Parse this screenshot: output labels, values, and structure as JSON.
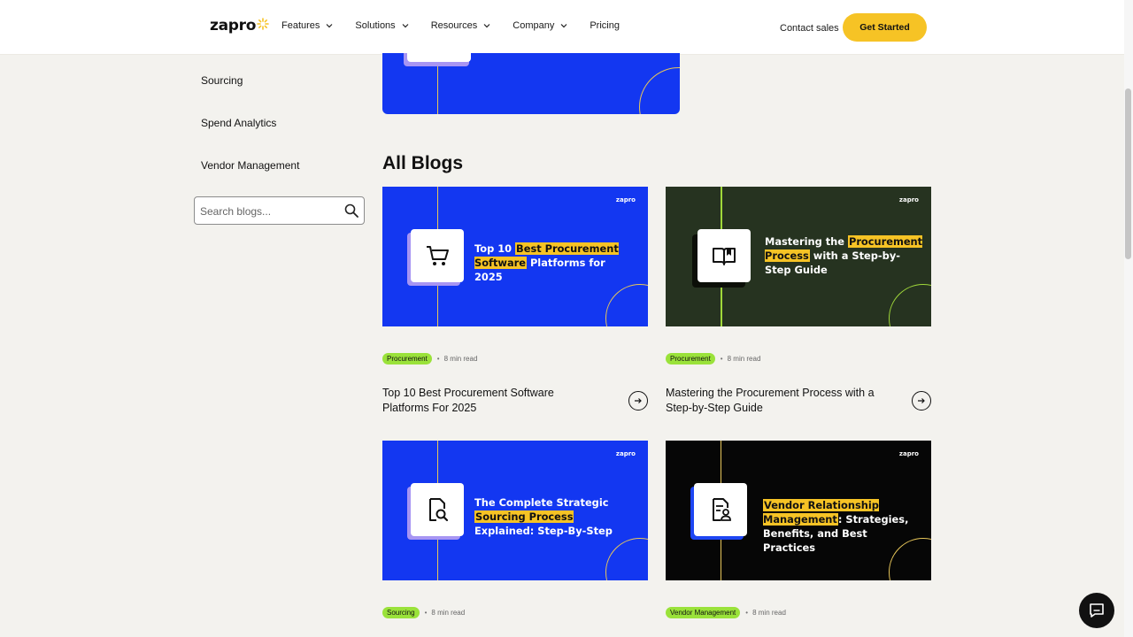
{
  "header": {
    "logo": "zapro",
    "nav": [
      "Features",
      "Solutions",
      "Resources",
      "Company",
      "Pricing"
    ],
    "contact_label": "Contact sales",
    "cta_label": "Get Started"
  },
  "sidebar": {
    "items": [
      "Sourcing",
      "Spend Analytics",
      "Vendor Management"
    ],
    "search_placeholder": "Search blogs..."
  },
  "main": {
    "heading": "All Blogs",
    "cards": [
      {
        "image_text_pre": "Top 10 ",
        "image_text_hl": "Best Procurement Software",
        "image_text_post": " Platforms for 2025",
        "tag": "Procurement",
        "read_time": "8 min read",
        "title": "Top 10 Best Procurement Software Platforms For 2025",
        "bg": "#1337f1",
        "icon": "shopping-cart-icon"
      },
      {
        "image_text_pre": "Mastering the ",
        "image_text_hl": "Procurement Process",
        "image_text_post": " with a Step-by-Step Guide",
        "tag": "Procurement",
        "read_time": "8 min read",
        "title": "Mastering the Procurement Process with a Step-by-Step Guide",
        "bg": "#263320",
        "icon": "open-book-icon"
      },
      {
        "image_text_pre": "The Complete Strategic ",
        "image_text_hl": "Sourcing Process",
        "image_text_post": " Explained: Step-By-Step",
        "tag": "Sourcing",
        "read_time": "8 min read",
        "bg": "#1337f1",
        "icon": "document-search-icon"
      },
      {
        "image_text_pre": "",
        "image_text_hl": "Vendor Relationship Management",
        "image_text_post": ": Strategies, Benefits, and Best Practices",
        "tag": "Vendor Management",
        "read_time": "8 min read",
        "bg": "#060606",
        "icon": "document-user-icon"
      }
    ]
  },
  "colors": {
    "accent_yellow": "#f6c325",
    "tag_green": "#9ae23a",
    "brand_blue": "#1337f1"
  }
}
